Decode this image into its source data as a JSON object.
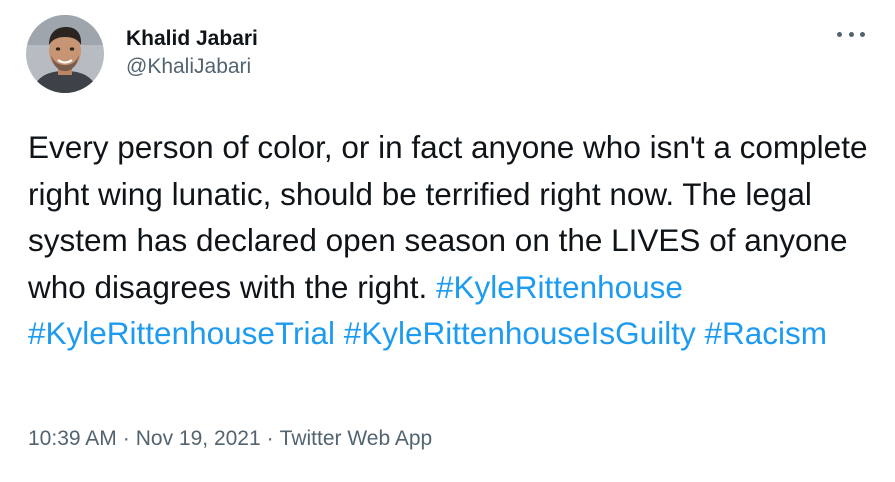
{
  "author": {
    "display_name": "Khalid Jabari",
    "handle": "@KhaliJabari",
    "avatar": "profile-photo"
  },
  "tweet": {
    "text_lines": [
      "Every person of color, or in fact anyone who isn't a",
      "complete right wing lunatic, should be terrified",
      "right now.  The legal system has declared open",
      "season on the LIVES of anyone who disagrees with",
      "the right."
    ],
    "hashtags": [
      "#KyleRittenhouse",
      "#KyleRittenhouseTrial",
      "#KyleRittenhouseIsGuilty",
      "#Racism"
    ]
  },
  "meta": {
    "time": "10:39 AM",
    "separator": "·",
    "date": "Nov 19, 2021",
    "source": "Twitter Web App"
  },
  "menu": {
    "icon": "more-horizontal-icon"
  },
  "colors": {
    "text": "#0f1419",
    "secondary": "#536471",
    "link": "#1d9bf0",
    "background": "#ffffff"
  }
}
